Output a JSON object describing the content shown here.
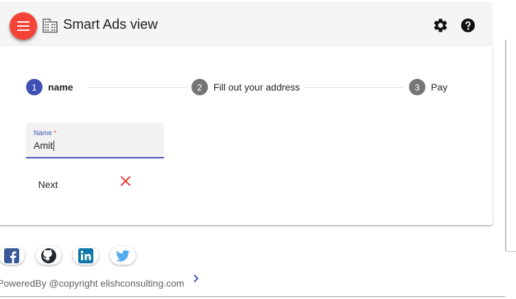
{
  "toolbar": {
    "menu_icon": "hamburger-icon",
    "app_icon": "building-icon",
    "title": "Smart Ads view",
    "settings_icon": "gear-icon",
    "help_icon": "help-icon"
  },
  "stepper": {
    "steps": [
      {
        "number": "1",
        "label": "name",
        "state": "active"
      },
      {
        "number": "2",
        "label": "Fill out your address",
        "state": "pending"
      },
      {
        "number": "3",
        "label": "Pay",
        "state": "pending"
      }
    ]
  },
  "form": {
    "name_label": "Name",
    "required_mark": "*",
    "name_value": "Amit",
    "next_label": "Next",
    "cancel_icon": "close-icon"
  },
  "footer": {
    "social": [
      {
        "name": "facebook",
        "icon": "facebook-icon"
      },
      {
        "name": "github",
        "icon": "github-icon"
      },
      {
        "name": "linkedin",
        "icon": "linkedin-icon"
      },
      {
        "name": "twitter",
        "icon": "twitter-icon"
      }
    ],
    "copyright": "PoweredBy @copyright elishconsulting.com",
    "expand_icon": "chevron-right-icon"
  },
  "colors": {
    "primary": "#3f51b5",
    "accent": "#f44336",
    "toolbar_bg": "#f5f5f5",
    "step_idle": "#757575"
  }
}
